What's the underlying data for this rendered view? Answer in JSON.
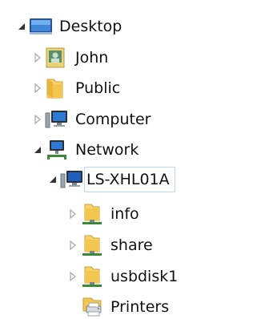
{
  "tree": {
    "nodes": [
      {
        "key": "desktop",
        "label": "Desktop",
        "icon": "desktop-icon",
        "toggle": "expanded"
      },
      {
        "key": "john",
        "label": "John",
        "icon": "user-folder-icon",
        "toggle": "collapsed"
      },
      {
        "key": "public",
        "label": "Public",
        "icon": "folder-icon",
        "toggle": "collapsed"
      },
      {
        "key": "computer",
        "label": "Computer",
        "icon": "computer-icon",
        "toggle": "collapsed"
      },
      {
        "key": "network",
        "label": "Network",
        "icon": "network-icon",
        "toggle": "expanded"
      },
      {
        "key": "ls-xhl01a",
        "label": "LS-XHL01A",
        "icon": "server-icon",
        "toggle": "expanded"
      },
      {
        "key": "info",
        "label": "info",
        "icon": "share-folder-icon",
        "toggle": "collapsed"
      },
      {
        "key": "share",
        "label": "share",
        "icon": "share-folder-icon",
        "toggle": "collapsed"
      },
      {
        "key": "usbdisk1",
        "label": "usbdisk1",
        "icon": "share-folder-icon",
        "toggle": "collapsed"
      },
      {
        "key": "printers",
        "label": "Printers",
        "icon": "printers-icon",
        "toggle": "none"
      }
    ],
    "selected": "ls-xhl01a"
  },
  "colors": {
    "selection_border": "#b9d7ee",
    "toggle_expanded": "#333333",
    "toggle_collapsed": "#a6a6a6",
    "folder_yellow": "#f3c74f",
    "monitor_blue": "#1f5fbf"
  }
}
